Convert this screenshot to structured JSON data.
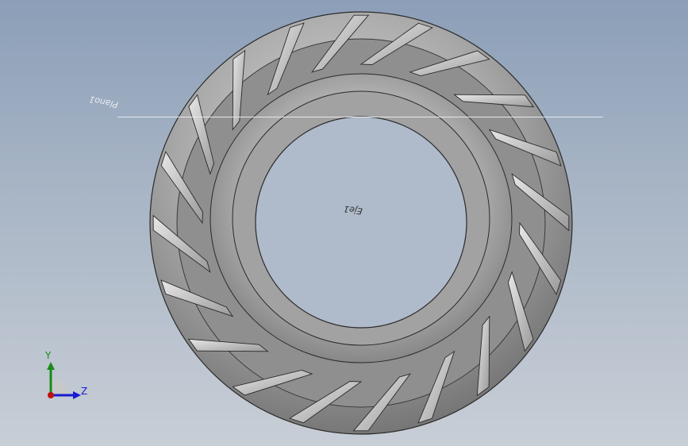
{
  "plane": {
    "label": "Plano1"
  },
  "axis": {
    "label": "Eje1"
  },
  "triad": {
    "y_label": "Y",
    "z_label": "Z"
  },
  "colors": {
    "background_top": "#8c9fb8",
    "background_bottom": "#c8ced6",
    "tire": "#9a9a9a",
    "y_axis": "#1a8a1a",
    "z_axis": "#1a1ad0",
    "origin": "#c01010"
  },
  "model": {
    "object": "tire",
    "lug_count": 20
  }
}
